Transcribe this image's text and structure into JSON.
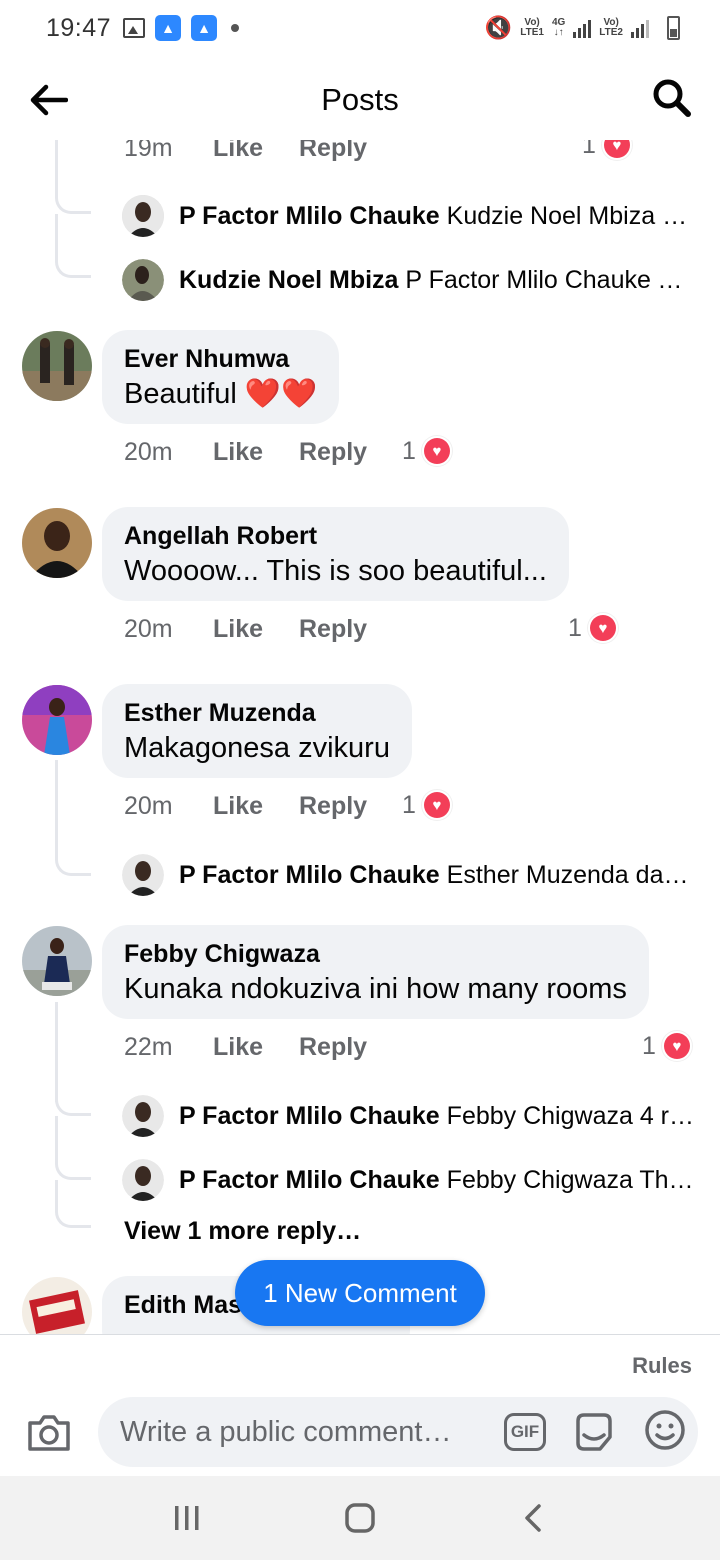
{
  "status_bar": {
    "time": "19:47",
    "sim1": [
      "Vo)",
      "LTE1"
    ],
    "net": [
      "4G",
      "↓↑"
    ],
    "sim2": [
      "Vo)",
      "LTE2"
    ],
    "icons": [
      "image-icon",
      "app-icon",
      "app-icon",
      "dot-icon",
      "mute-icon",
      "signal-icon",
      "battery-icon"
    ]
  },
  "header": {
    "title": "Posts",
    "back_icon": "arrow-left-icon",
    "search_icon": "search-icon"
  },
  "top_partial": {
    "time": "19m",
    "like": "Like",
    "reply": "Reply",
    "reactions": "1"
  },
  "early_replies": [
    {
      "name": "P Factor Mlilo Chauke",
      "text": "Kudzie Noel Mbiza d…"
    },
    {
      "name": "Kudzie Noel Mbiza",
      "text": "P Factor Mlilo Chauke Y…"
    }
  ],
  "comments": [
    {
      "name": "Ever Nhumwa",
      "text": "Beautiful ❤️❤️",
      "time": "20m",
      "like": "Like",
      "reply": "Reply",
      "reactions": "1"
    },
    {
      "name": "Angellah Robert",
      "text": "Woooow... This is soo beautiful...",
      "time": "20m",
      "like": "Like",
      "reply": "Reply",
      "reactions": "1"
    },
    {
      "name": "Esther Muzenda",
      "text": "Makagonesa zvikuru",
      "time": "20m",
      "like": "Like",
      "reply": "Reply",
      "reactions": "1",
      "replies": [
        {
          "name": "P Factor Mlilo Chauke",
          "text": "Esther Muzenda dan…"
        }
      ]
    },
    {
      "name": "Febby Chigwaza",
      "text": "Kunaka ndokuziva ini how many rooms",
      "time": "22m",
      "like": "Like",
      "reply": "Reply",
      "reactions": "1",
      "replies": [
        {
          "name": "P Factor Mlilo Chauke",
          "text": "Febby Chigwaza 4 ro…"
        },
        {
          "name": "P Factor Mlilo Chauke",
          "text": "Febby Chigwaza Th…"
        }
      ],
      "view_more": "View 1 more reply…"
    },
    {
      "name": "Edith Mas"
    }
  ],
  "new_comment_pill": "1 New Comment",
  "composer": {
    "rules": "Rules",
    "placeholder": "Write a public comment…",
    "gif": "GIF",
    "icons": [
      "camera-icon",
      "gif-icon",
      "sticker-icon",
      "emoji-icon"
    ]
  },
  "colors": {
    "accent": "#1877f2",
    "bubble": "#f0f2f5",
    "heart": "#f33e58",
    "muted": "#65676b"
  }
}
